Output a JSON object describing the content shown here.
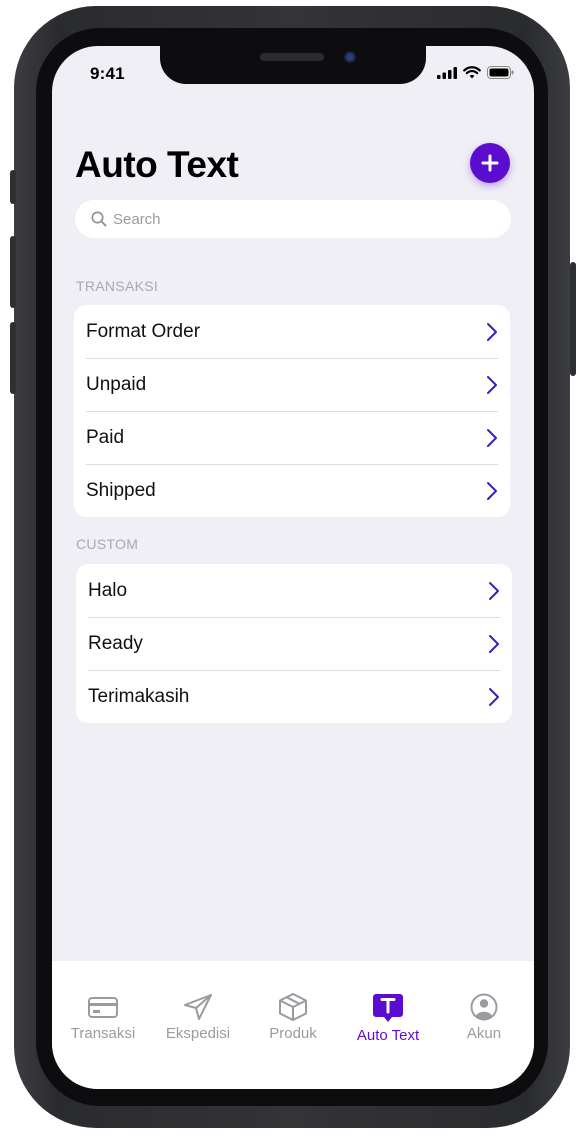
{
  "status_bar": {
    "time": "9:41"
  },
  "header": {
    "title": "Auto Text",
    "add_icon": "plus-icon"
  },
  "search": {
    "placeholder": "Search",
    "value": ""
  },
  "sections": [
    {
      "label": "TRANSAKSI",
      "items": [
        "Format Order",
        "Unpaid",
        "Paid",
        "Shipped"
      ]
    },
    {
      "label": "CUSTOM",
      "items": [
        "Halo",
        "Ready",
        "Terimakasih"
      ]
    }
  ],
  "tabbar": {
    "tabs": [
      {
        "label": "Transaksi",
        "icon": "card-icon"
      },
      {
        "label": "Ekspedisi",
        "icon": "send-icon"
      },
      {
        "label": "Produk",
        "icon": "box-icon"
      },
      {
        "label": "Auto Text",
        "icon": "auto-text-icon",
        "active": true
      },
      {
        "label": "Akun",
        "icon": "user-icon"
      }
    ]
  },
  "colors": {
    "accent": "#5b0ccf",
    "background": "#f0eff5",
    "inactive": "#9a9aa0"
  }
}
